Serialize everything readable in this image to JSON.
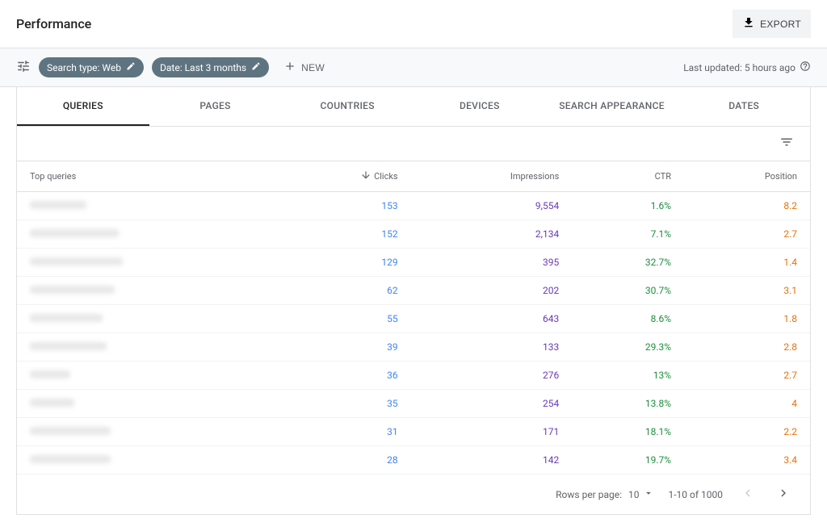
{
  "header": {
    "title": "Performance",
    "export_label": "EXPORT"
  },
  "filters": {
    "search_type": "Search type: Web",
    "date_range": "Date: Last 3 months",
    "new_label": "NEW",
    "last_updated": "Last updated: 5 hours ago"
  },
  "tabs": [
    {
      "label": "QUERIES",
      "active": true
    },
    {
      "label": "PAGES",
      "active": false
    },
    {
      "label": "COUNTRIES",
      "active": false
    },
    {
      "label": "DEVICES",
      "active": false
    },
    {
      "label": "SEARCH APPEARANCE",
      "active": false
    },
    {
      "label": "DATES",
      "active": false
    }
  ],
  "table": {
    "columns": {
      "query": "Top queries",
      "clicks": "Clicks",
      "impressions": "Impressions",
      "ctr": "CTR",
      "position": "Position"
    },
    "rows": [
      {
        "blur_w": 70,
        "clicks": "153",
        "impressions": "9,554",
        "ctr": "1.6%",
        "position": "8.2"
      },
      {
        "blur_w": 110,
        "clicks": "152",
        "impressions": "2,134",
        "ctr": "7.1%",
        "position": "2.7"
      },
      {
        "blur_w": 115,
        "clicks": "129",
        "impressions": "395",
        "ctr": "32.7%",
        "position": "1.4"
      },
      {
        "blur_w": 105,
        "clicks": "62",
        "impressions": "202",
        "ctr": "30.7%",
        "position": "3.1"
      },
      {
        "blur_w": 90,
        "clicks": "55",
        "impressions": "643",
        "ctr": "8.6%",
        "position": "1.8"
      },
      {
        "blur_w": 95,
        "clicks": "39",
        "impressions": "133",
        "ctr": "29.3%",
        "position": "2.8"
      },
      {
        "blur_w": 50,
        "clicks": "36",
        "impressions": "276",
        "ctr": "13%",
        "position": "2.7"
      },
      {
        "blur_w": 55,
        "clicks": "35",
        "impressions": "254",
        "ctr": "13.8%",
        "position": "4"
      },
      {
        "blur_w": 100,
        "clicks": "31",
        "impressions": "171",
        "ctr": "18.1%",
        "position": "2.2"
      },
      {
        "blur_w": 100,
        "clicks": "28",
        "impressions": "142",
        "ctr": "19.7%",
        "position": "3.4"
      }
    ]
  },
  "pagination": {
    "rows_per_page_label": "Rows per page:",
    "rows_per_page_value": "10",
    "range_label": "1-10 of 1000"
  }
}
